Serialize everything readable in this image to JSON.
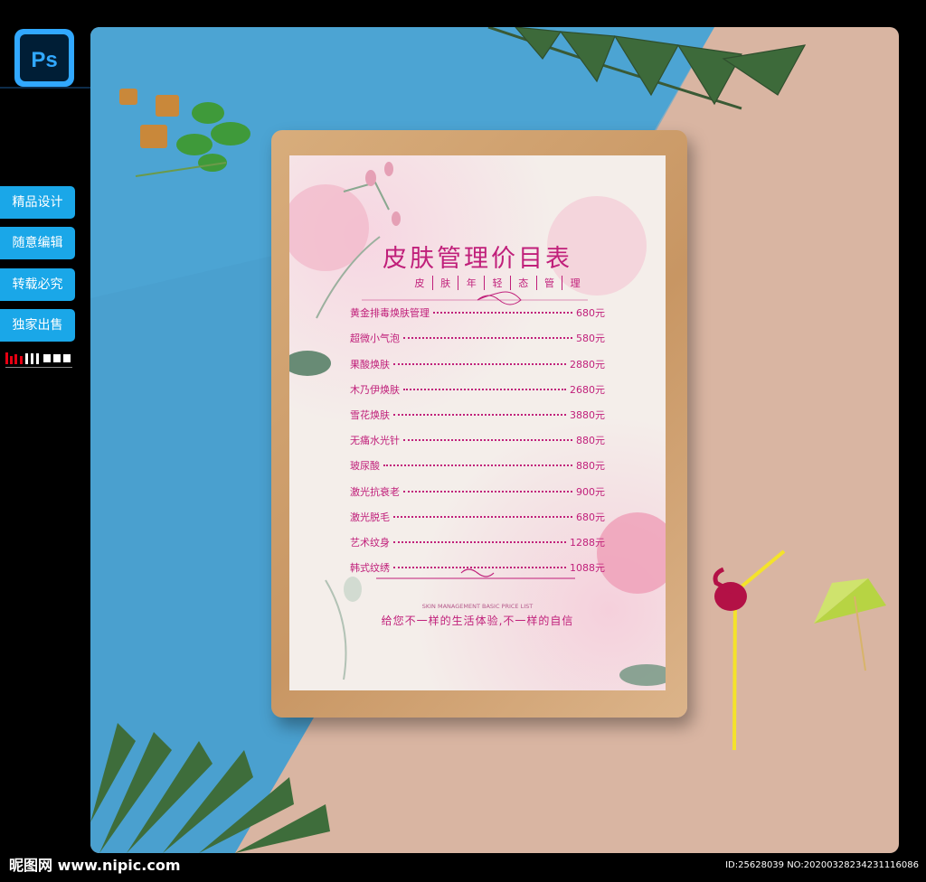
{
  "app": {
    "icon": "photoshop-icon",
    "icon_text": "Ps",
    "accent": "#1aa7e8"
  },
  "sidebar": {
    "items": [
      {
        "label": "精品设计"
      },
      {
        "label": "随意编辑"
      },
      {
        "label": "转载必究"
      },
      {
        "label": "独家出售"
      }
    ],
    "brand_logo": "nipic-logo"
  },
  "menu": {
    "title": "皮肤管理价目表",
    "subtitle": [
      "皮",
      "肤",
      "年",
      "轻",
      "态",
      "管",
      "理"
    ],
    "items": [
      {
        "name": "黄金排毒焕肤管理",
        "price": "680元"
      },
      {
        "name": "超微小气泡",
        "price": "580元"
      },
      {
        "name": "果酸焕肤",
        "price": "2880元"
      },
      {
        "name": "木乃伊焕肤",
        "price": "2680元"
      },
      {
        "name": "雪花焕肤",
        "price": "3880元"
      },
      {
        "name": "无痛水光针",
        "price": "880元"
      },
      {
        "name": "玻尿酸",
        "price": "880元"
      },
      {
        "name": "激光抗衰老",
        "price": "900元"
      },
      {
        "name": "激光脱毛",
        "price": "680元"
      },
      {
        "name": "艺术纹身",
        "price": "1288元"
      },
      {
        "name": "韩式纹绣",
        "price": "1088元"
      }
    ],
    "footer_en": "SKIN MANAGEMENT BASIC PRICE LIST",
    "footer_cn": "给您不一样的生活体验,不一样的自信",
    "accent_color": "#c01f7a"
  },
  "watermark": {
    "left": "昵图网 www.nipic.com",
    "right": "ID:25628039 NO:20200328234231116086"
  }
}
